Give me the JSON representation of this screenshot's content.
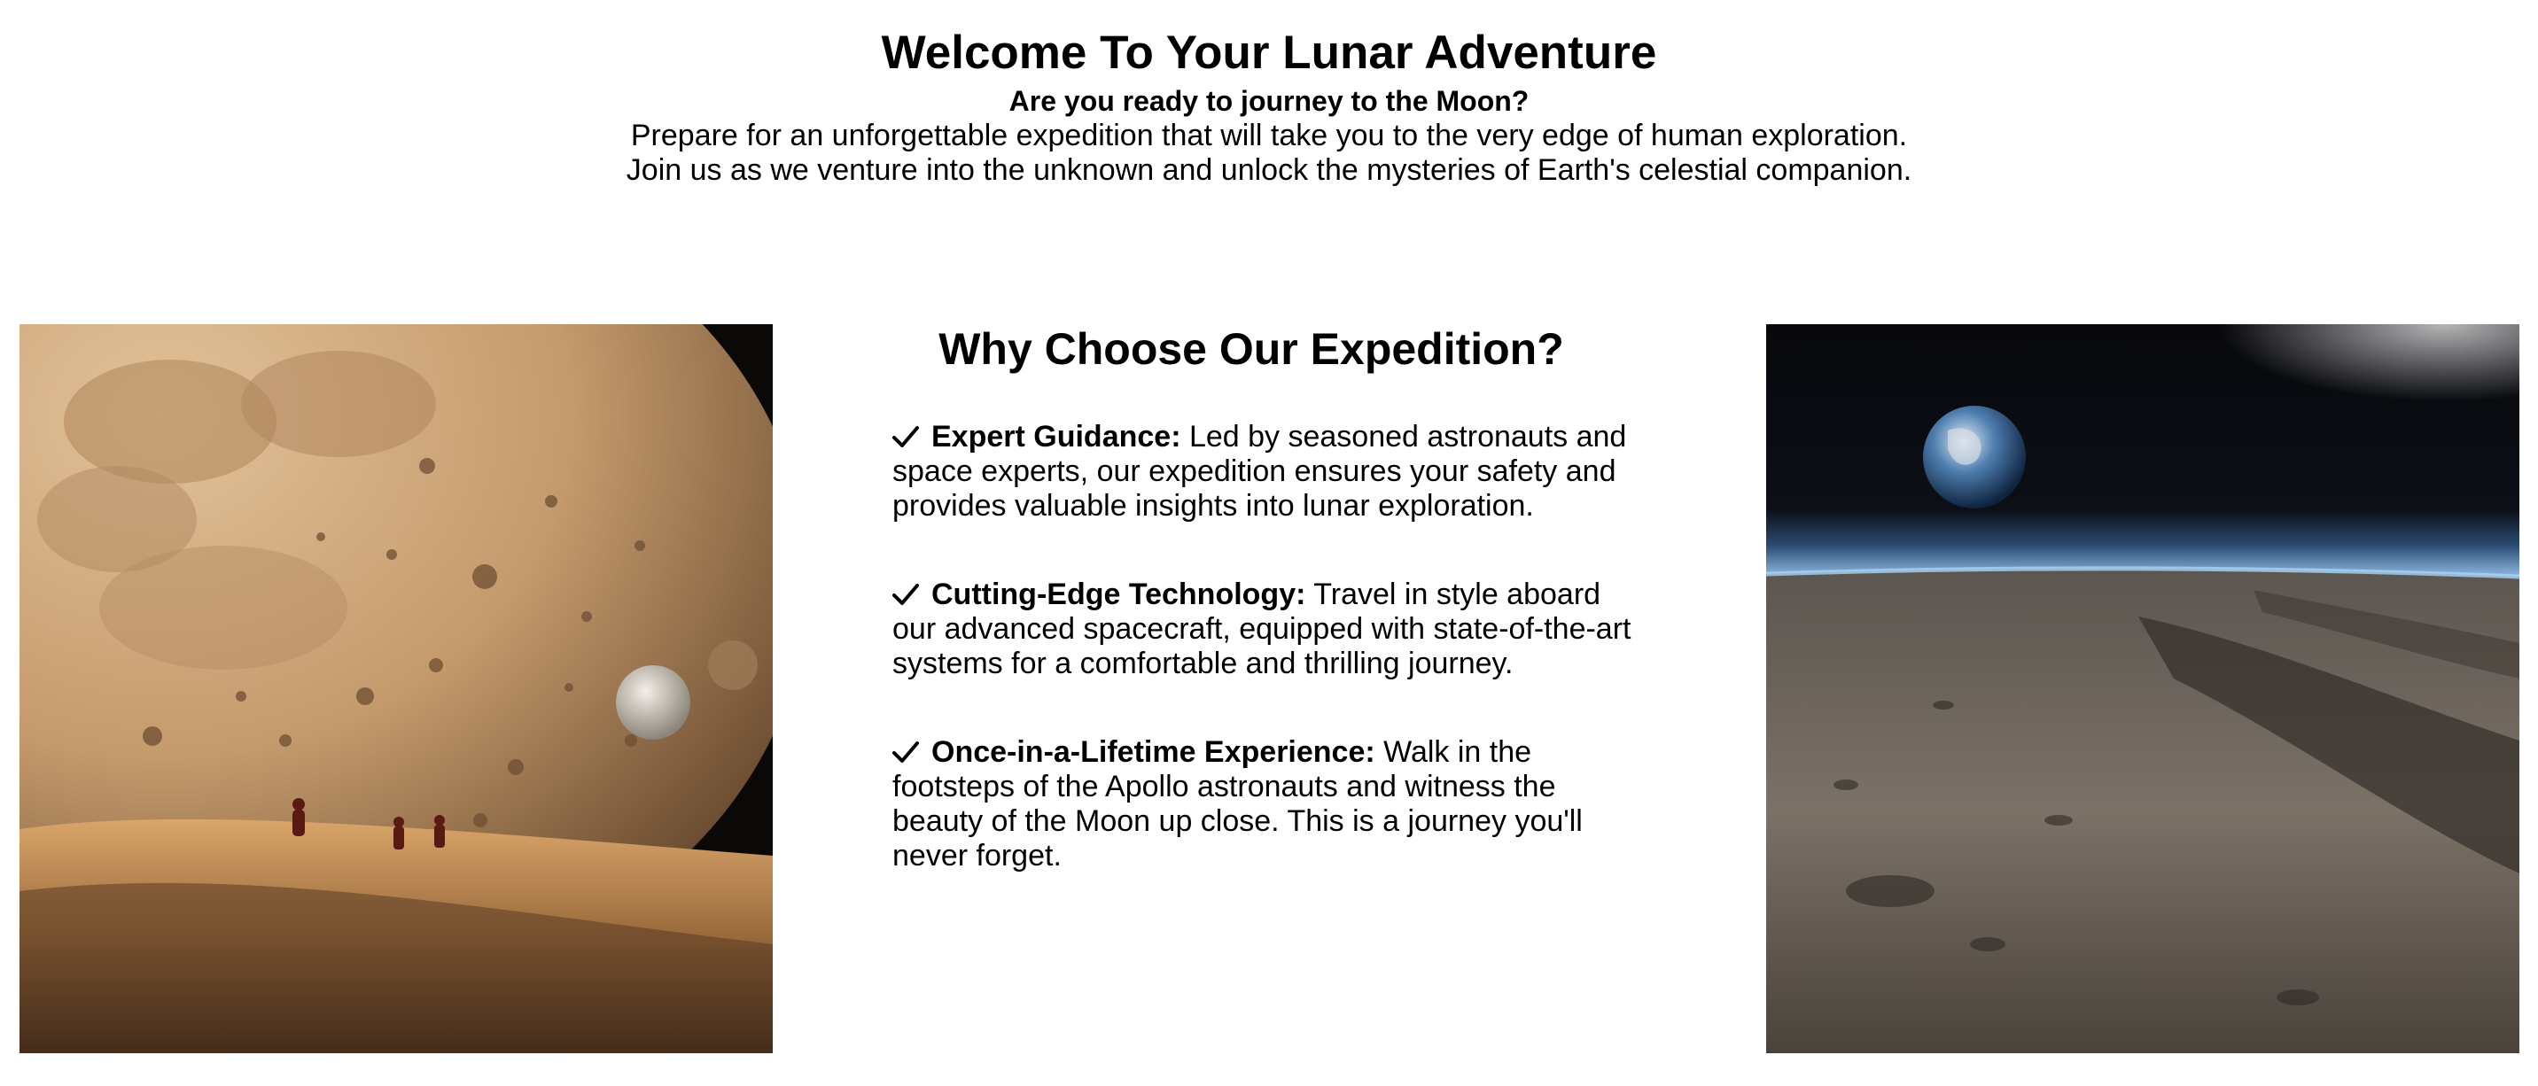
{
  "hero": {
    "title": "Welcome To Your Lunar Adventure",
    "subtitle": "Are you ready to journey to the Moon?",
    "line1": "Prepare for an unforgettable expedition that will take you to the very edge of human exploration.",
    "line2": "Join us as we venture into the unknown and unlock the mysteries of Earth's celestial companion."
  },
  "features": {
    "heading": "Why Choose Our Expedition?",
    "check_icon": "checkmark-icon",
    "items": [
      {
        "label": "Expert Guidance:",
        "text": " Led by seasoned astronauts and space experts, our expedition ensures your safety and provides valuable insights into lunar exploration."
      },
      {
        "label": "Cutting-Edge Technology:",
        "text": " Travel in style aboard our advanced spacecraft, equipped with state-of-the-art systems for a comfortable and thrilling journey."
      },
      {
        "label": "Once-in-a-Lifetime Experience:",
        "text": " Walk in the footsteps of the Apollo astronauts and witness the beauty of the Moon up close. This is a journey you'll never forget."
      }
    ]
  },
  "images": {
    "left": "moon-surface-astronauts-image",
    "right": "earth-over-lunar-horizon-image"
  },
  "colors": {
    "text": "#000000",
    "background": "#ffffff",
    "moon_tan": "#c29a6e",
    "space_dark": "#0a0b10",
    "atmosphere_blue": "#7fb2e6",
    "lunar_grey": "#6e655b"
  }
}
